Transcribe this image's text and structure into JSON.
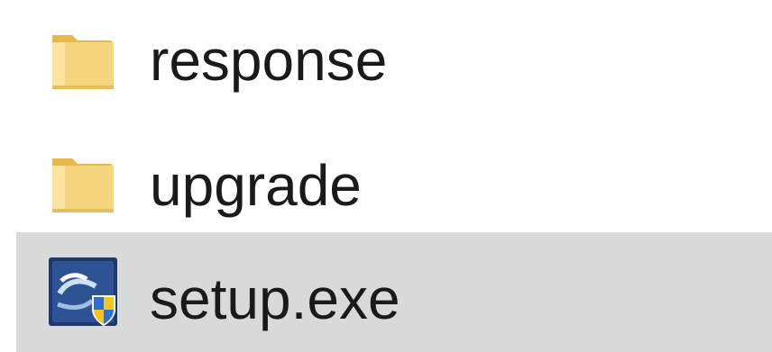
{
  "file_list": {
    "items": [
      {
        "name": "response",
        "type": "folder",
        "icon": "folder-icon",
        "selected": false
      },
      {
        "name": "upgrade",
        "type": "folder",
        "icon": "folder-icon",
        "selected": false
      },
      {
        "name": "setup.exe",
        "type": "application",
        "icon": "installer-shield-icon",
        "selected": true
      }
    ]
  },
  "colors": {
    "selection_background": "#d9d9d9",
    "folder_yellow": "#f4d170",
    "text": "#1a1a1a"
  }
}
